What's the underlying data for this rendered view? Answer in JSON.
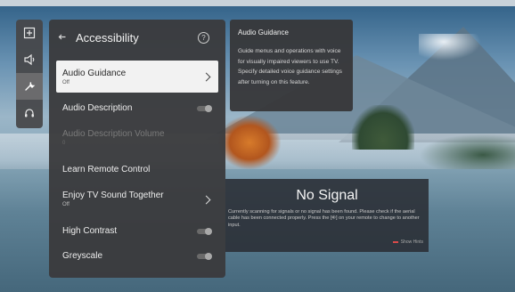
{
  "rail": {
    "items": [
      {
        "icon": "input-icon"
      },
      {
        "icon": "speaker-icon"
      },
      {
        "icon": "wrench-icon",
        "active": true
      },
      {
        "icon": "headset-icon"
      }
    ]
  },
  "menu": {
    "title": "Accessibility",
    "help_icon": "?",
    "items": [
      {
        "label": "Audio Guidance",
        "sub": "Off"
      },
      {
        "label": "Audio Description"
      },
      {
        "label": "Audio Description Volume",
        "sub": "0"
      },
      {
        "label": "Learn Remote Control"
      },
      {
        "label": "Enjoy TV Sound Together",
        "sub": "Off"
      },
      {
        "label": "High Contrast"
      },
      {
        "label": "Greyscale"
      }
    ]
  },
  "tooltip": {
    "title": "Audio Guidance",
    "body": "Guide menus and operations with voice for visually impaired viewers to use TV. Specify detailed voice guidance settings after turning on this feature."
  },
  "no_signal": {
    "title": "No Signal",
    "body": "Currently scanning for signals or no signal has been found. Please check if the aerial cable has been connected properly. Press the [⎆] on your remote to change to another input.",
    "action": "Show Hints"
  },
  "colors": {
    "accent": "#d94a4a",
    "panel": "#3a3a3c",
    "selected": "#f2f2f2"
  }
}
